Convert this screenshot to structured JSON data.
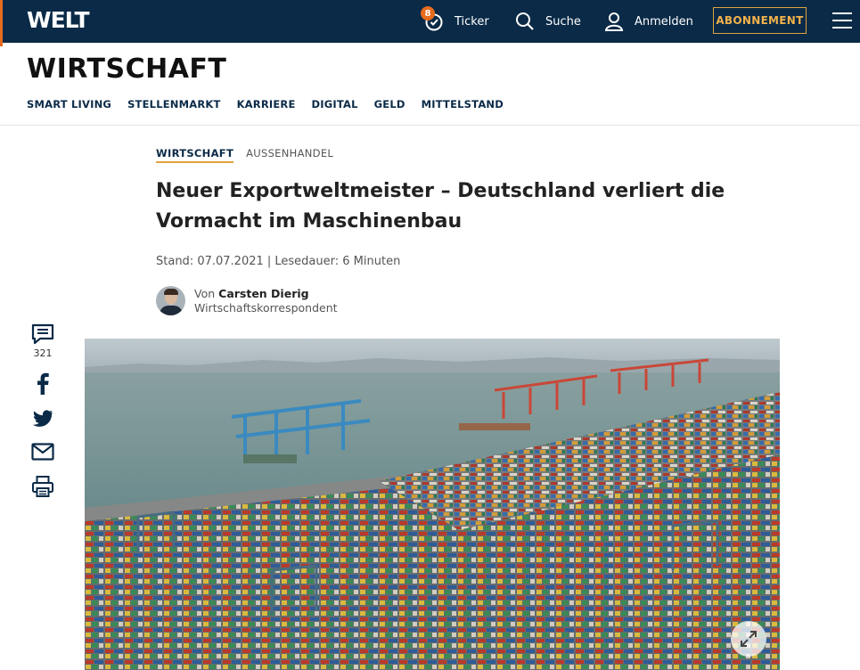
{
  "header": {
    "logo": "WELT",
    "ticker": {
      "label": "Ticker",
      "badge": "8"
    },
    "search_label": "Suche",
    "login_label": "Anmelden",
    "subscribe_label": "ABONNEMENT"
  },
  "section": {
    "title": "WIRTSCHAFT",
    "subnav": [
      "SMART LIVING",
      "STELLENMARKT",
      "KARRIERE",
      "DIGITAL",
      "GELD",
      "MITTELSTAND"
    ]
  },
  "article": {
    "kicker_primary": "WIRTSCHAFT",
    "kicker_secondary": "AUSSENHANDEL",
    "headline": "Neuer Exportweltmeister – Deutschland verliert die Vormacht im Maschinenbau",
    "meta": "Stand: 07.07.2021 | Lesedauer: 6 Minuten",
    "author_prefix": "Von",
    "author_name": "Carsten Dierig",
    "author_role": "Wirtschaftskorrespondent"
  },
  "share": {
    "comment_count": "321"
  },
  "colors": {
    "topbar": "#0a2a47",
    "accent": "#e0a33b",
    "orange": "#e76b1c"
  }
}
